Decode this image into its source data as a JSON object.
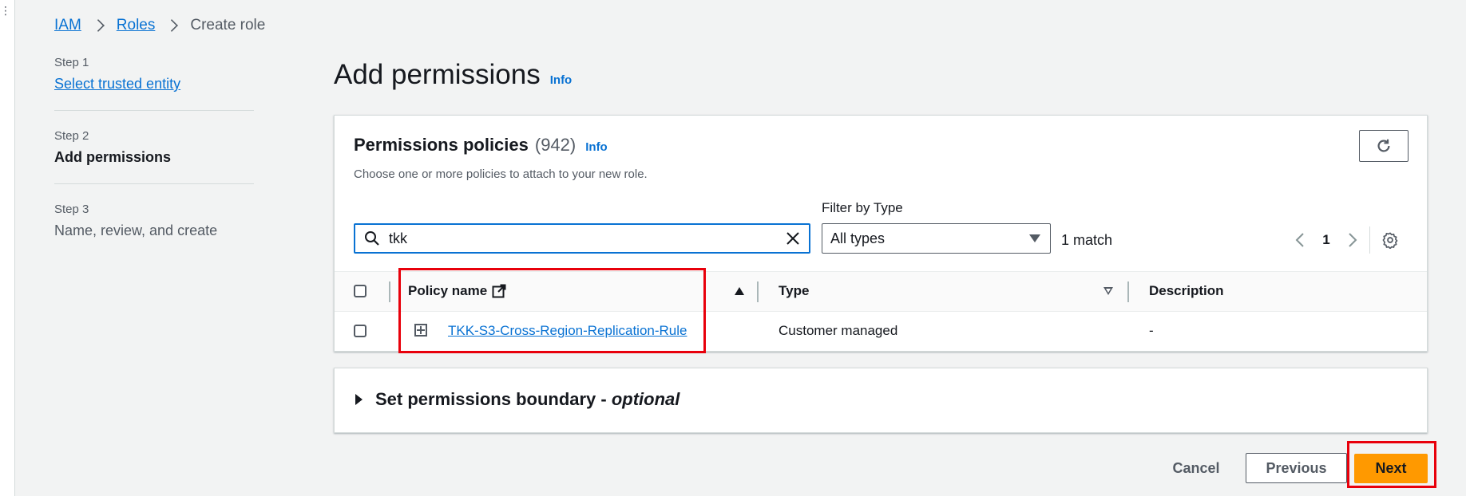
{
  "breadcrumb": {
    "iam": "IAM",
    "roles": "Roles",
    "current": "Create role"
  },
  "steps": [
    {
      "num": "Step 1",
      "title": "Select trusted entity"
    },
    {
      "num": "Step 2",
      "title": "Add permissions"
    },
    {
      "num": "Step 3",
      "title": "Name, review, and create"
    }
  ],
  "page": {
    "title": "Add permissions",
    "info": "Info"
  },
  "policies": {
    "title": "Permissions policies",
    "count": "(942)",
    "info": "Info",
    "description": "Choose one or more policies to attach to your new role.",
    "search_value": "tkk",
    "filter_label": "Filter by Type",
    "filter_value": "All types",
    "match_count": "1 match",
    "page_number": "1",
    "columns": {
      "name": "Policy name",
      "type": "Type",
      "description": "Description"
    },
    "rows": [
      {
        "name": "TKK-S3-Cross-Region-Replication-Rule",
        "type": "Customer managed",
        "description": "-"
      }
    ]
  },
  "boundary": {
    "title": "Set permissions boundary - ",
    "optional": "optional"
  },
  "footer": {
    "cancel": "Cancel",
    "previous": "Previous",
    "next": "Next"
  },
  "colors": {
    "link": "#0972d3",
    "primary": "#ff9900",
    "highlight": "#e8000b",
    "background": "#f2f3f3"
  }
}
